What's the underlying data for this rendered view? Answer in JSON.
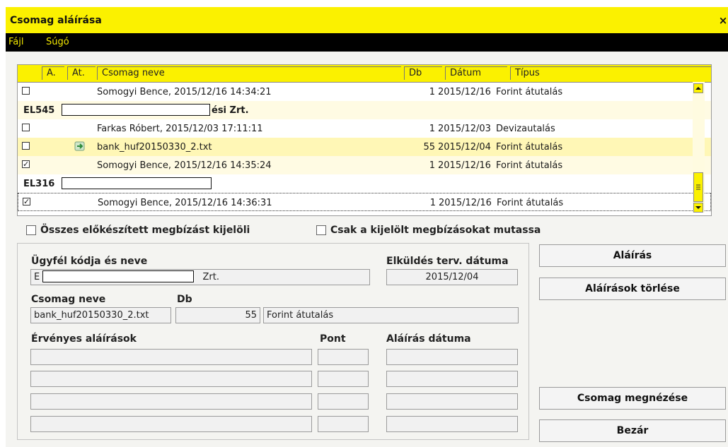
{
  "window": {
    "title": "Csomag aláírása",
    "close": "×"
  },
  "menu": [
    {
      "label": "Fájl"
    },
    {
      "label": "Súgó"
    }
  ],
  "table": {
    "columns": [
      "A.",
      "At.",
      "Csomag neve",
      "Db",
      "Dátum",
      "Típus"
    ],
    "rows": [
      {
        "name": "Somogyi Bence, 2015/12/16 14:34:21",
        "db": "1",
        "datum": "2015/12/16",
        "tipus": "Forint átutalás"
      },
      {
        "group_prefix": "EL545",
        "group_suffix": "ési Zrt."
      },
      {
        "name": "Farkas Róbert, 2015/12/03 17:11:11",
        "db": "1",
        "datum": "2015/12/03",
        "tipus": "Devizautalás"
      },
      {
        "name": "bank_huf20150330_2.txt",
        "db": "55",
        "datum": "2015/12/04",
        "tipus": "Forint átutalás"
      },
      {
        "name": "Somogyi Bence, 2015/12/16 14:35:24",
        "db": "1",
        "datum": "2015/12/16",
        "tipus": "Forint átutalás",
        "checkmark": "✓"
      },
      {
        "group_prefix": "EL316"
      },
      {
        "name": "Somogyi Bence, 2015/12/16 14:36:31",
        "db": "1",
        "datum": "2015/12/16",
        "tipus": "Forint átutalás",
        "checkmark": "✓"
      }
    ]
  },
  "options": {
    "select_all": "Összes előkészített megbízást kijelöli",
    "show_selected": "Csak a kijelölt megbízásokat mutassa"
  },
  "form": {
    "client_label": "Ügyfél kódja és neve",
    "client_prefix": "E",
    "client_suffix": "Zrt.",
    "send_date_label": "Elküldés terv. dátuma",
    "send_date": "2015/12/04",
    "package_label": "Csomag neve",
    "package_value": "bank_huf20150330_2.txt",
    "db_label": "Db",
    "db_value": "55",
    "type_value": "Forint átutalás",
    "valid_sig_label": "Érvényes aláírások",
    "point_label": "Pont",
    "sig_date_label": "Aláírás dátuma"
  },
  "buttons": {
    "sign": "Aláírás",
    "delete_sigs": "Aláírások törlése",
    "view_package": "Csomag megnézése",
    "close": "Bezár"
  },
  "colors": {
    "accent": "#fbf100",
    "menu_bg": "#000000",
    "menu_text": "#f3e800"
  }
}
